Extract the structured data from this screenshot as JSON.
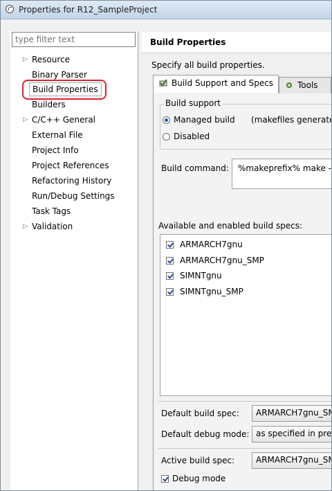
{
  "window": {
    "title": "Properties for R12_SampleProject"
  },
  "left": {
    "filter_placeholder": "type filter text",
    "tree": [
      {
        "label": "Resource",
        "expandable": true
      },
      {
        "label": "Binary Parser",
        "expandable": false
      },
      {
        "label": "Build Properties",
        "expandable": false,
        "selected": true
      },
      {
        "label": "Builders",
        "expandable": false
      },
      {
        "label": "C/C++ General",
        "expandable": true
      },
      {
        "label": "External File",
        "expandable": false
      },
      {
        "label": "Project Info",
        "expandable": false
      },
      {
        "label": "Project References",
        "expandable": false
      },
      {
        "label": "Refactoring History",
        "expandable": false
      },
      {
        "label": "Run/Debug Settings",
        "expandable": false
      },
      {
        "label": "Task Tags",
        "expandable": false
      },
      {
        "label": "Validation",
        "expandable": true
      }
    ]
  },
  "right": {
    "title": "Build Properties",
    "description": "Specify all build properties.",
    "tabs": [
      {
        "label": "Build Support and Specs",
        "active": true
      },
      {
        "label": "Tools",
        "active": false
      }
    ],
    "build_support": {
      "group_title": "Build support",
      "managed": "Managed build",
      "managed_note": "(makefiles generated",
      "disabled": "Disabled",
      "selected": "managed"
    },
    "build_command": {
      "label": "Build command:",
      "value": "%makeprefix% make -"
    },
    "specs": {
      "label": "Available and enabled build specs:",
      "items": [
        {
          "label": "ARMARCH7gnu",
          "checked": true
        },
        {
          "label": "ARMARCH7gnu_SMP",
          "checked": true
        },
        {
          "label": "SIMNTgnu",
          "checked": true
        },
        {
          "label": "SIMNTgnu_SMP",
          "checked": true
        }
      ]
    },
    "default_build_spec": {
      "label": "Default build spec:",
      "value": "ARMARCH7gnu_SM"
    },
    "default_debug_mode": {
      "label": "Default debug mode:",
      "value": "as specified in prefe"
    },
    "active_build_spec": {
      "label": "Active build spec:",
      "value": "ARMARCH7gnu_SM"
    },
    "debug_mode": {
      "label": "Debug mode",
      "checked": true
    }
  },
  "colors": {
    "highlight": "#e21d2d",
    "titlebar": "#c3d4e7",
    "check": "#2b4d91"
  }
}
